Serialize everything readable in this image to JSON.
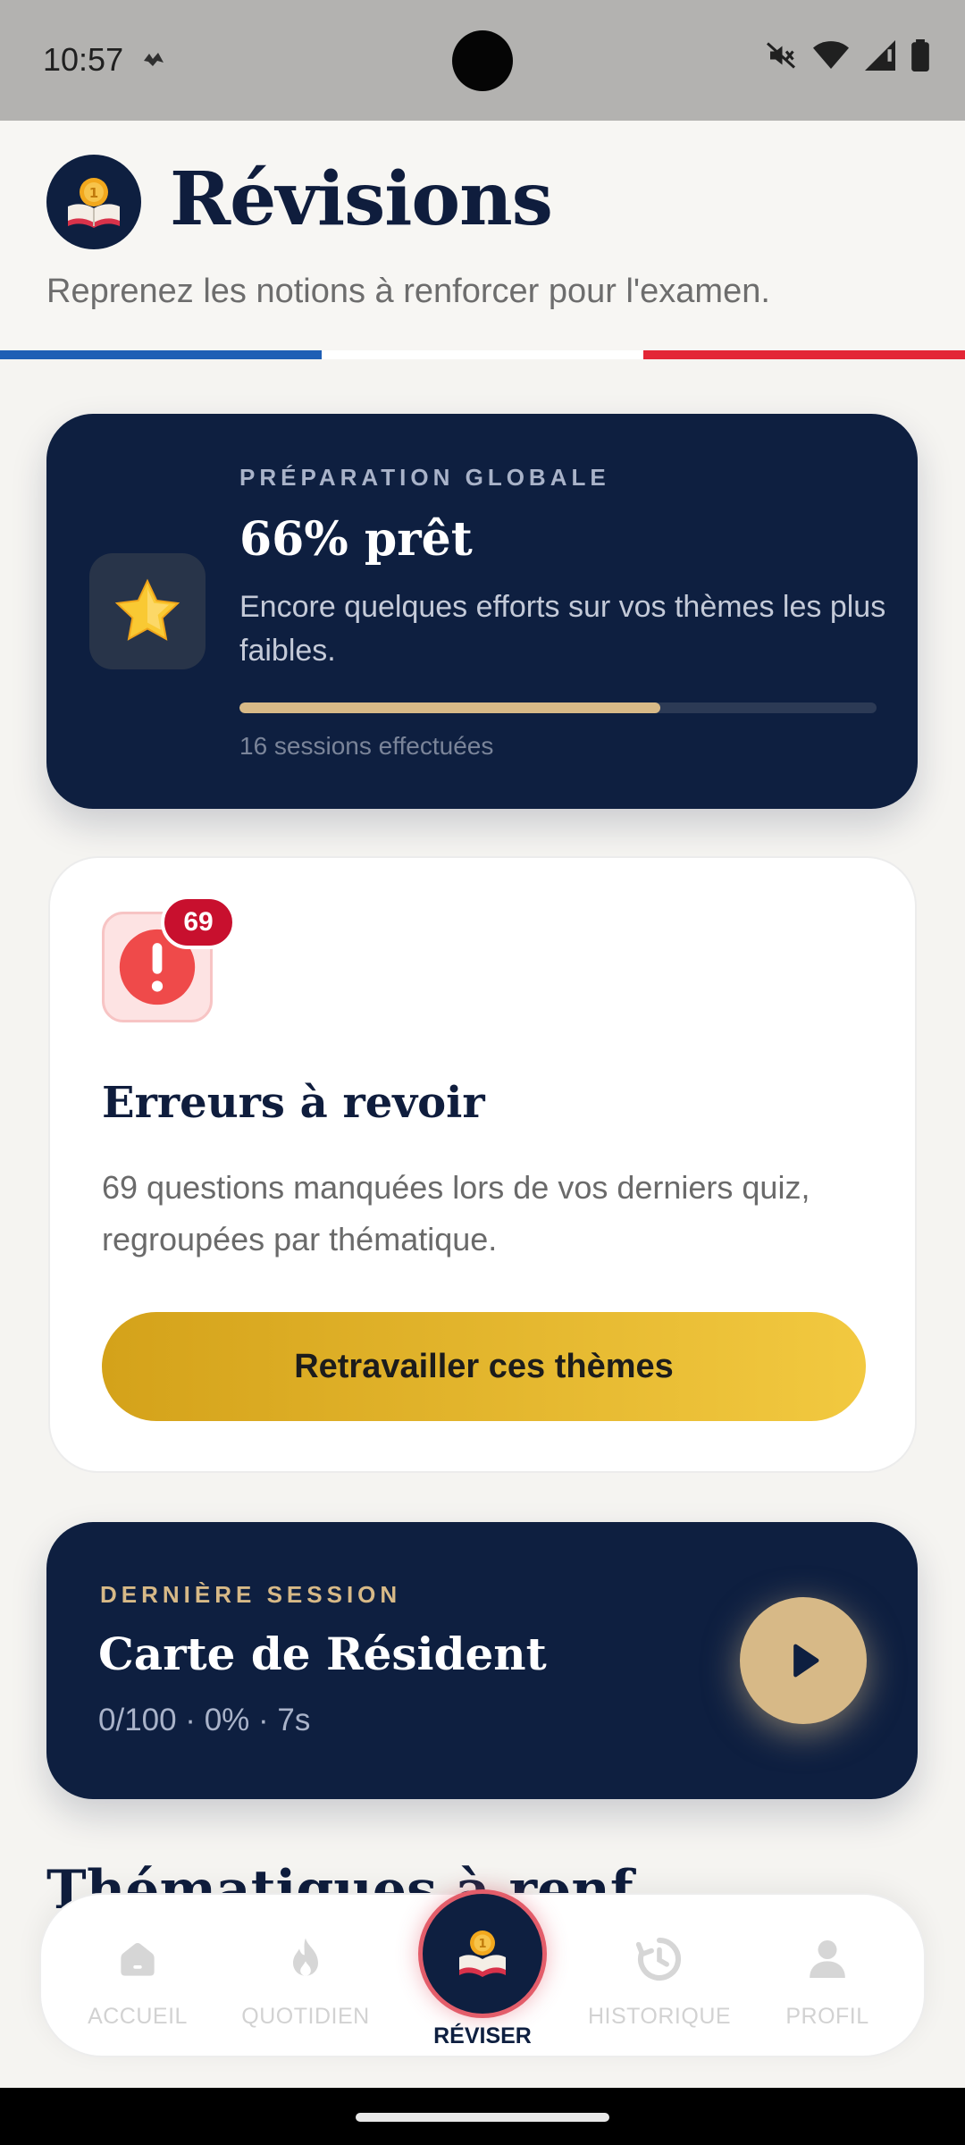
{
  "status_bar": {
    "time": "10:57"
  },
  "header": {
    "title": "Révisions",
    "subtitle": "Reprenez les notions à renforcer pour l'examen.",
    "flag_colors": [
      "#1f5fb5",
      "#ffffff",
      "#e32636"
    ]
  },
  "prep_card": {
    "label": "PRÉPARATION GLOBALE",
    "value": "66% prêt",
    "progress": 0.66,
    "description": "Encore quelques efforts sur vos thèmes les plus faibles.",
    "sessions": "16 sessions effectuées",
    "icon": "star-icon"
  },
  "errors_card": {
    "badge": "69",
    "title": "Erreurs à revoir",
    "description": "69 questions manquées lors de vos derniers quiz, regroupées par thématique.",
    "button_label": "Retravailler ces thèmes",
    "icon": "alert-icon"
  },
  "last_session": {
    "label": "DERNIÈRE SESSION",
    "title": "Carte de Résident",
    "meta": "0/100 · 0% · 7s",
    "icon": "play-icon"
  },
  "section_heading": "Thématiques à renf…",
  "bottom_nav": {
    "items": [
      {
        "label": "ACCUEIL",
        "icon": "home-icon"
      },
      {
        "label": "QUOTIDIEN",
        "icon": "flame-icon"
      },
      {
        "label": "RÉVISER",
        "icon": "book-medal-icon"
      },
      {
        "label": "HISTORIQUE",
        "icon": "history-icon"
      },
      {
        "label": "PROFIL",
        "icon": "person-icon"
      }
    ]
  },
  "colors": {
    "navy": "#0e1f40",
    "gold": "#d7b987",
    "yellow": "#f2c940",
    "red": "#c8102e"
  }
}
